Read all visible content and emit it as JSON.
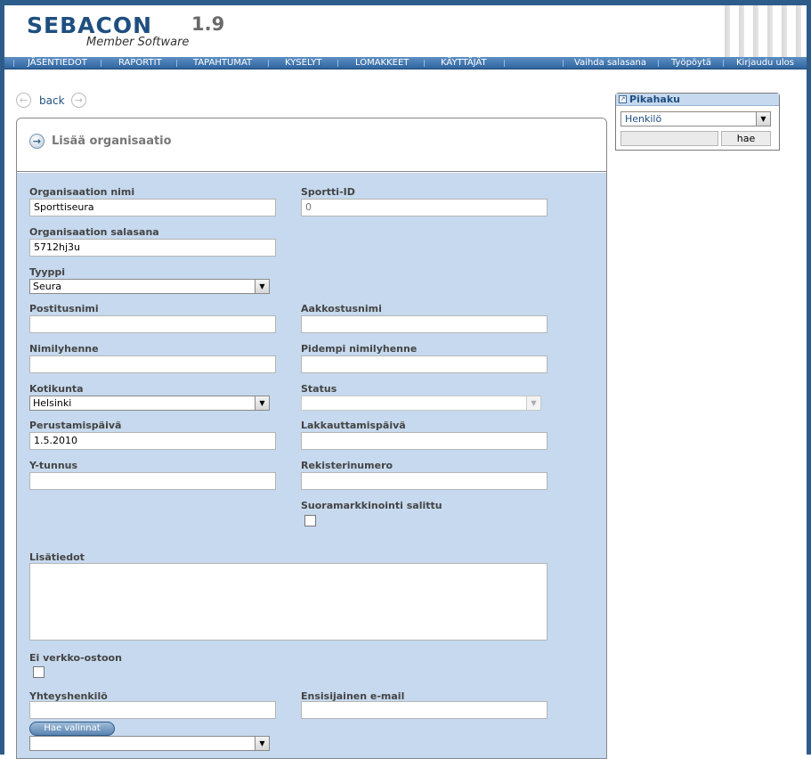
{
  "header": {
    "logo": "SEBACON",
    "version": "1.9",
    "subtitle": "Member Software"
  },
  "nav": {
    "left": [
      "JÄSENTIEDOT",
      "RAPORTIT",
      "TAPAHTUMAT",
      "KYSELYT",
      "LOMAKKEET",
      "KÄYTTÄJÄT"
    ],
    "right": [
      "Vaihda salasana",
      "Työpöytä",
      "Kirjaudu ulos"
    ]
  },
  "back": {
    "label": "back"
  },
  "panel": {
    "title": "Lisää organisaatio"
  },
  "form": {
    "org_name": {
      "label": "Organisaation nimi",
      "value": "Sporttiseura"
    },
    "sportti_id": {
      "label": "Sportti-ID",
      "value": "0"
    },
    "org_password": {
      "label": "Organisaation salasana",
      "value": "5712hj3u"
    },
    "type": {
      "label": "Tyyppi",
      "value": "Seura"
    },
    "postal_name": {
      "label": "Postitusnimi",
      "value": ""
    },
    "alpha_name": {
      "label": "Aakkostusnimi",
      "value": ""
    },
    "short_name": {
      "label": "Nimilyhenne",
      "value": ""
    },
    "long_short_name": {
      "label": "Pidempi nimilyhenne",
      "value": ""
    },
    "home_town": {
      "label": "Kotikunta",
      "value": "Helsinki"
    },
    "status": {
      "label": "Status",
      "value": ""
    },
    "founded": {
      "label": "Perustamispäivä",
      "value": "1.5.2010"
    },
    "closed": {
      "label": "Lakkauttamispäivä",
      "value": ""
    },
    "y_tunnus": {
      "label": "Y-tunnus",
      "value": ""
    },
    "register_no": {
      "label": "Rekisterinumero",
      "value": ""
    },
    "no_direct_marketing": {
      "label": "Suoramarkkinointi salittu",
      "checked": false
    },
    "extra_info": {
      "label": "Lisätiedot",
      "value": ""
    },
    "no_web_purchase": {
      "label": "Ei verkko-ostoon",
      "checked": false
    },
    "contact_person": {
      "label": "Yhteyshenkilö",
      "value": ""
    },
    "primary_email": {
      "label": "Ensisijainen e-mail",
      "value": ""
    },
    "fetch_button": "Hae valinnat",
    "fetch_select": {
      "value": ""
    }
  },
  "quick_search": {
    "title": "Pikahaku",
    "select_value": "Henkilö",
    "input_value": "",
    "button": "hae"
  },
  "icons": {
    "back": "arrow-left-circle-icon",
    "forward": "arrow-right-circle-icon",
    "title": "arrow-right-circle-icon",
    "dropdown": "triangle-down-icon",
    "quick": "window-icon"
  },
  "colors": {
    "brand": "#1f4f80",
    "nav_bg": "#2f649e",
    "form_bg": "#c6d9ee",
    "frame": "#2e5c8a"
  }
}
